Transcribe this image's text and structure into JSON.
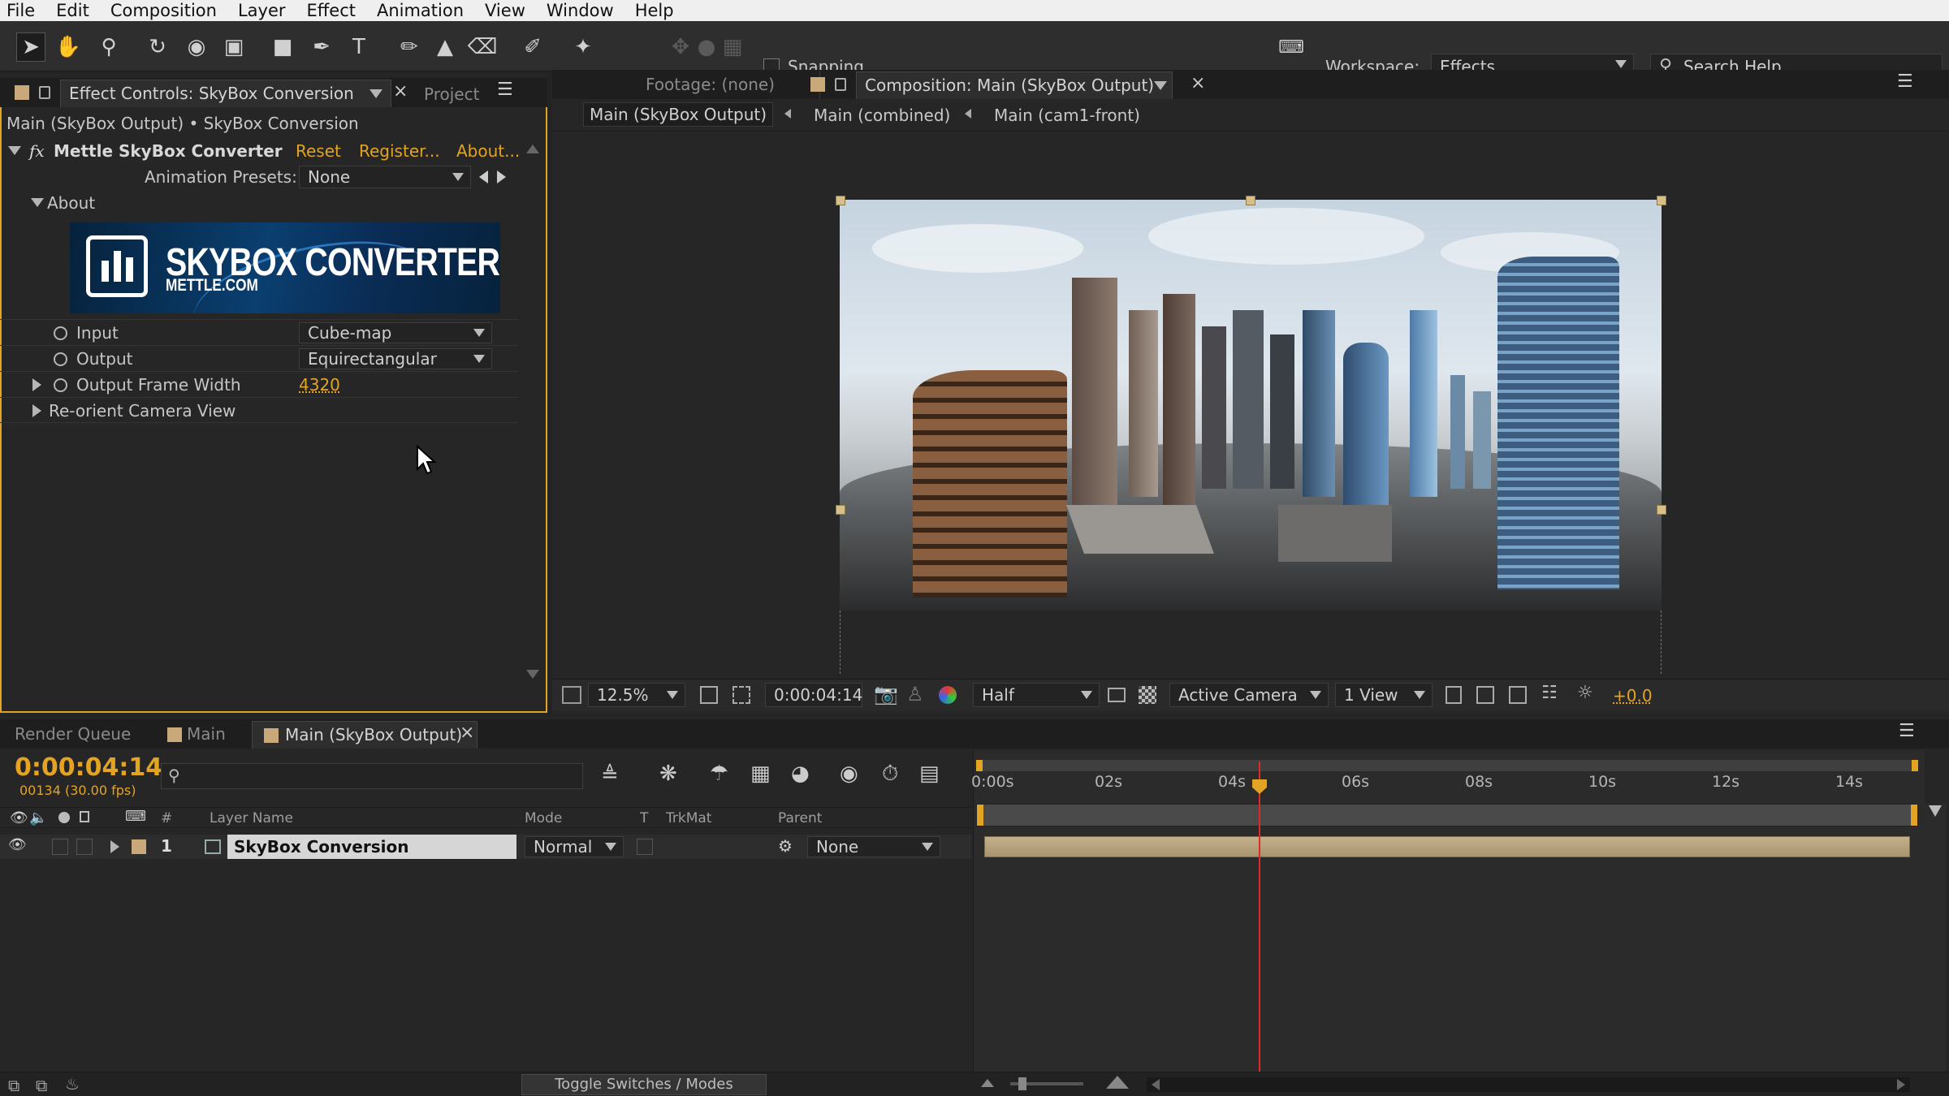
{
  "menu": [
    "File",
    "Edit",
    "Composition",
    "Layer",
    "Effect",
    "Animation",
    "View",
    "Window",
    "Help"
  ],
  "toolbar": {
    "snapping_label": "Snapping",
    "workspace_label": "Workspace:",
    "workspace_value": "Effects",
    "search_placeholder": "Search Help"
  },
  "effect_panel": {
    "tab_label": "Effect Controls: SkyBox Conversion",
    "project_tab": "Project",
    "breadcrumb": "Main (SkyBox Output) • SkyBox Conversion",
    "fx_symbol": "fx",
    "effect_name": "Mettle SkyBox Converter",
    "reset_link": "Reset",
    "register_link": "Register...",
    "about_link": "About...",
    "presets_label": "Animation Presets:",
    "presets_value": "None",
    "about_group": "About",
    "logo_title": "SKYBOX CONVERTER",
    "logo_subtitle": "METTLE.COM",
    "input_label": "Input",
    "input_value": "Cube-map",
    "output_label": "Output",
    "output_value": "Equirectangular",
    "frame_width_label": "Output Frame Width",
    "frame_width_value": "4320",
    "reorient_label": "Re-orient Camera View"
  },
  "viewer": {
    "footage_tab": "Footage: (none)",
    "comp_tab": "Composition: Main (SkyBox Output)",
    "crumbs": [
      "Main (SkyBox Output)",
      "Main (combined)",
      "Main (cam1-front)"
    ],
    "zoom": "12.5%",
    "timecode": "0:00:04:14",
    "resolution": "Half",
    "camera": "Active Camera",
    "views": "1 View",
    "exposure": "+0.0"
  },
  "timeline": {
    "tabs": [
      "Render Queue",
      "Main",
      "Main (SkyBox Output)"
    ],
    "timecode": "0:00:04:14",
    "frame_info": "00134 (30.00 fps)",
    "search_placeholder": "",
    "columns": {
      "hash": "#",
      "layer_name": "Layer Name",
      "mode": "Mode",
      "t": "T",
      "trkmat": "TrkMat",
      "parent": "Parent"
    },
    "ruler": [
      "0:00s",
      "02s",
      "04s",
      "06s",
      "08s",
      "10s",
      "12s",
      "14s"
    ],
    "layer": {
      "index": "1",
      "name": "SkyBox Conversion",
      "mode": "Normal",
      "parent": "None"
    },
    "toggle_label": "Toggle Switches / Modes"
  },
  "colors": {
    "accent": "#e3a423",
    "layer_bar": "#b8a47c",
    "playhead": "#e02a2a"
  }
}
